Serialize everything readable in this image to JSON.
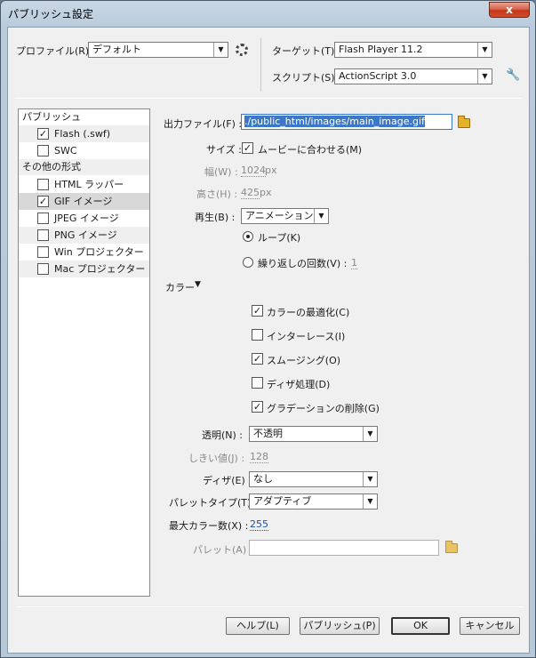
{
  "window": {
    "title": "パブリッシュ設定",
    "close_label": "x"
  },
  "header": {
    "profile_label": "プロファイル(R) :",
    "profile_value": "デフォルト",
    "target_label": "ターゲット(T) :",
    "target_value": "Flash Player 11.2",
    "script_label": "スクリプト(S) :",
    "script_value": "ActionScript 3.0"
  },
  "sidebar": {
    "publish_header": "パブリッシュ",
    "publish_items": [
      {
        "label": "Flash (.swf)",
        "checked": true
      },
      {
        "label": "SWC",
        "checked": false
      }
    ],
    "other_header": "その他の形式",
    "other_items": [
      {
        "label": "HTML ラッパー",
        "checked": false
      },
      {
        "label": "GIF イメージ",
        "checked": true
      },
      {
        "label": "JPEG イメージ",
        "checked": false
      },
      {
        "label": "PNG イメージ",
        "checked": false
      },
      {
        "label": "Win プロジェクター",
        "checked": false
      },
      {
        "label": "Mac プロジェクター",
        "checked": false
      }
    ]
  },
  "form": {
    "output_label": "出力ファイル(F) :",
    "output_value": "./public_html/images/main_image.gif",
    "size_label": "サイズ :",
    "match_movie_label": "ムービーに合わせる(M)",
    "width_label": "幅(W) :",
    "width_value": "1024",
    "height_label": "高さ(H) :",
    "height_value": "425",
    "px": "px",
    "playback_label": "再生(B) :",
    "playback_value": "アニメーション",
    "loop_label": "ループ(K)",
    "repeat_label": "繰り返しの回数(V) :",
    "repeat_value": "1",
    "color_section": "カラー",
    "color_optimize": "カラーの最適化(C)",
    "interlace": "インターレース(I)",
    "smoothing": "スムージング(O)",
    "dither_process": "ディザ処理(D)",
    "remove_gradient": "グラデーションの削除(G)",
    "transparency_label": "透明(N) :",
    "transparency_value": "不透明",
    "threshold_label": "しきい値(J) :",
    "threshold_value": "128",
    "dither_label": "ディザ(E) :",
    "dither_value": "なし",
    "palette_type_label": "パレットタイプ(T) :",
    "palette_type_value": "アダプティブ",
    "max_colors_label": "最大カラー数(X) :",
    "max_colors_value": "255",
    "palette_label": "パレット(A) :"
  },
  "footer": {
    "help": "ヘルプ(L)",
    "publish": "パブリッシュ(P)",
    "ok": "OK",
    "cancel": "キャンセル"
  }
}
